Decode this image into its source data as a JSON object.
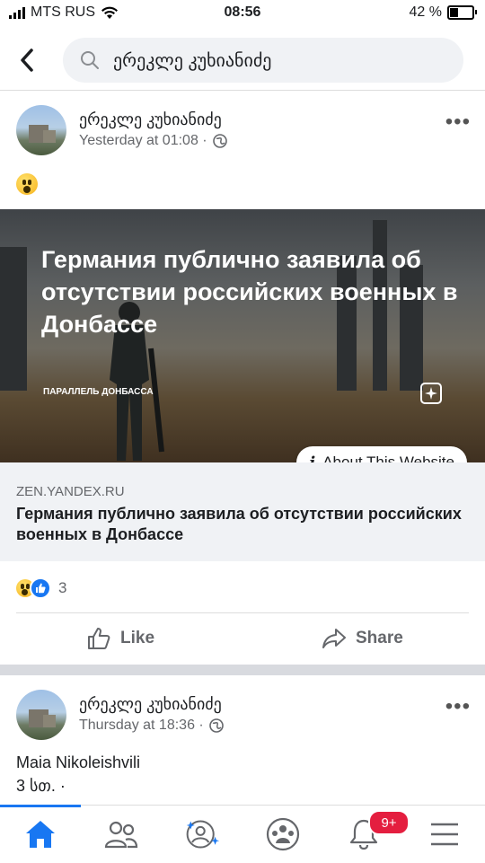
{
  "status_bar": {
    "carrier": "MTS RUS",
    "time": "08:56",
    "battery": "42 %"
  },
  "search": {
    "query": "ერეკლე კუხიანიძე"
  },
  "post1": {
    "author": "ერეკლე კუხიანიძე",
    "time": "Yesterday at 01:08 ·",
    "link": {
      "image_headline": "Германия публично заявила об отсутствии российских военных в Донбассе",
      "image_source_tag": "ПАРАЛЛЕЛЬ ДОНБАССА",
      "about_label": "About This Website",
      "domain": "ZEN.YANDEX.RU",
      "title": "Германия публично заявила об отсутствии российских военных в Донбассе"
    },
    "reaction_count": "3",
    "like_label": "Like",
    "share_label": "Share"
  },
  "post2": {
    "author": "ერეკლე კუხიანიძე",
    "time": "Thursday at 18:36 ·",
    "text_line1": "Maia Nikoleishvili",
    "text_line2": "3 სთ. ·"
  },
  "tabbar": {
    "notifications_badge": "9+",
    "active_tab": "home"
  },
  "colors": {
    "accent": "#1877f2",
    "badge": "#e41e3f"
  }
}
